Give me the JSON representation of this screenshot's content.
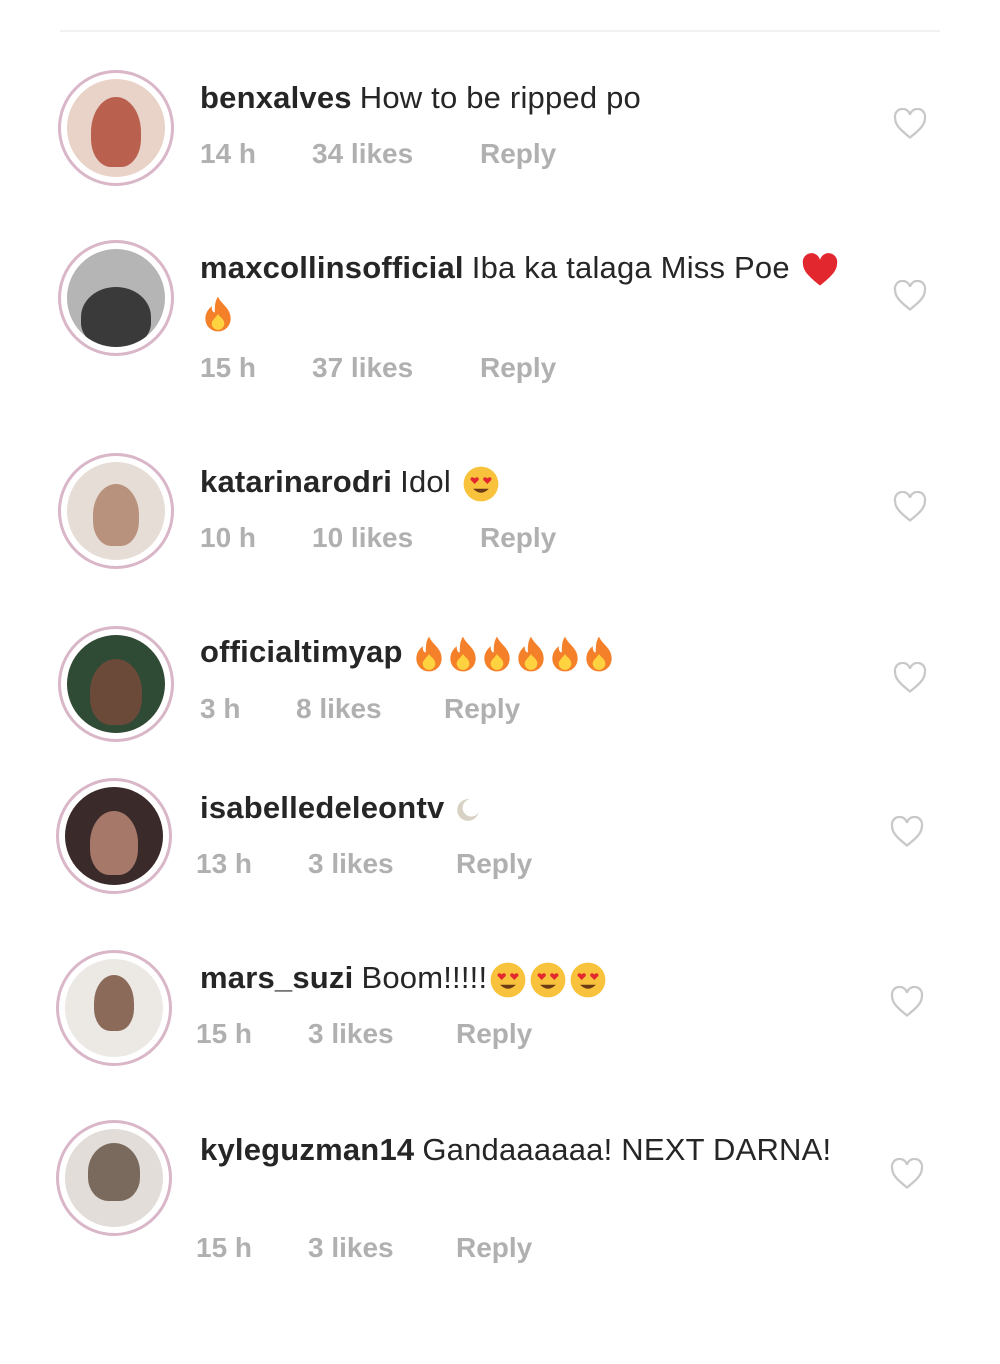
{
  "comments": [
    {
      "username": "benxalves",
      "text": "How to be ripped po",
      "emojis": [],
      "time": "14 h",
      "likes": "34 likes",
      "reply": "Reply",
      "avatar_color": "#c88a7a"
    },
    {
      "username": "maxcollinsofficial",
      "text": "Iba ka talaga Miss Poe",
      "emojis": [
        "red-heart",
        "fire"
      ],
      "time": "15 h",
      "likes": "37 likes",
      "reply": "Reply",
      "avatar_color": "#4a4a4a"
    },
    {
      "username": "katarinarodri",
      "text": "Idol",
      "emojis": [
        "heart-eyes"
      ],
      "time": "10 h",
      "likes": "10 likes",
      "reply": "Reply",
      "avatar_color": "#b9a59a"
    },
    {
      "username": "officialtimyap",
      "text": "",
      "emojis": [
        "fire",
        "fire",
        "fire",
        "fire",
        "fire",
        "fire"
      ],
      "time": "3 h",
      "likes": "8 likes",
      "reply": "Reply",
      "avatar_color": "#3d5a3d"
    },
    {
      "username": "isabelledeleontv",
      "text": "",
      "emojis": [
        "moon"
      ],
      "time": "13 h",
      "likes": "3 likes",
      "reply": "Reply",
      "avatar_color": "#2a2020"
    },
    {
      "username": "mars_suzi",
      "text": "Boom!!!!!",
      "emojis": [
        "heart-eyes",
        "heart-eyes",
        "heart-eyes"
      ],
      "time": "15 h",
      "likes": "3 likes",
      "reply": "Reply",
      "avatar_color": "#d8d4cf"
    },
    {
      "username": "kyleguzman14",
      "text": "Gandaaaaaa! NEXT DARNA!",
      "emojis": [],
      "time": "15 h",
      "likes": "3 likes",
      "reply": "Reply",
      "avatar_color": "#9a8c80"
    }
  ],
  "colors": {
    "avatar_ring": "#d9b6c8",
    "meta_text": "#b0b0b0",
    "heart_outline": "#c8c8c8"
  }
}
